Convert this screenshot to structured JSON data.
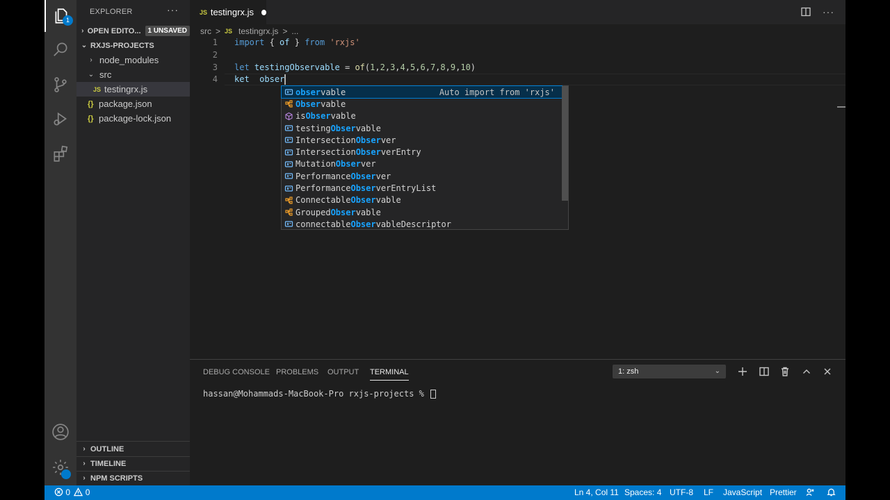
{
  "activity": {
    "explorer_badge": "1"
  },
  "sidebar": {
    "title": "EXPLORER",
    "more": "···",
    "open_editors": {
      "label": "OPEN EDITO...",
      "badge": "1 UNSAVED"
    },
    "project": "RXJS-PROJECTS",
    "tree": [
      {
        "label": "node_modules",
        "type": "folder"
      },
      {
        "label": "src",
        "type": "folder-open"
      },
      {
        "label": "testingrx.js",
        "type": "js",
        "icon": "JS"
      },
      {
        "label": "package.json",
        "type": "json",
        "icon": "{}"
      },
      {
        "label": "package-lock.json",
        "type": "json",
        "icon": "{}"
      }
    ],
    "sections": [
      "OUTLINE",
      "TIMELINE",
      "NPM SCRIPTS"
    ]
  },
  "tab": {
    "icon": "JS",
    "label": "testingrx.js"
  },
  "tab_actions": {
    "more": "···"
  },
  "breadcrumb": {
    "folder": "src",
    "sep": ">",
    "icon": "JS",
    "file": "testingrx.js",
    "more": "..."
  },
  "code": {
    "lines": [
      {
        "n": "1",
        "tokens": [
          [
            "kw",
            "import"
          ],
          [
            "pl",
            " { "
          ],
          [
            "var",
            "of"
          ],
          [
            "pl",
            " } "
          ],
          [
            "kw",
            "from"
          ],
          [
            "pl",
            " "
          ],
          [
            "str",
            "'rxjs'"
          ]
        ]
      },
      {
        "n": "2",
        "tokens": []
      },
      {
        "n": "3",
        "tokens": [
          [
            "kw",
            "let"
          ],
          [
            "pl",
            " "
          ],
          [
            "var",
            "testingObservable"
          ],
          [
            "pl",
            " = "
          ],
          [
            "fn",
            "of"
          ],
          [
            "pl",
            "("
          ],
          [
            "num",
            "1"
          ],
          [
            "pl",
            ","
          ],
          [
            "num",
            "2"
          ],
          [
            "pl",
            ","
          ],
          [
            "num",
            "3"
          ],
          [
            "pl",
            ","
          ],
          [
            "num",
            "4"
          ],
          [
            "pl",
            ","
          ],
          [
            "num",
            "5"
          ],
          [
            "pl",
            ","
          ],
          [
            "num",
            "6"
          ],
          [
            "pl",
            ","
          ],
          [
            "num",
            "7"
          ],
          [
            "pl",
            ","
          ],
          [
            "num",
            "8"
          ],
          [
            "pl",
            ","
          ],
          [
            "num",
            "9"
          ],
          [
            "pl",
            ","
          ],
          [
            "num",
            "10"
          ],
          [
            "pl",
            ")"
          ]
        ]
      },
      {
        "n": "4",
        "tokens": [
          [
            "var",
            "ket"
          ],
          [
            "pl",
            "  "
          ],
          [
            "var",
            "obser"
          ]
        ]
      }
    ]
  },
  "suggest": {
    "items": [
      {
        "icon": "variable",
        "pre": "",
        "match": "obser",
        "post": "vable",
        "detail": "Auto import from 'rxjs'"
      },
      {
        "icon": "class",
        "pre": "",
        "match": "Obser",
        "post": "vable",
        "detail": ""
      },
      {
        "icon": "module",
        "pre": "is",
        "match": "Obser",
        "post": "vable",
        "detail": ""
      },
      {
        "icon": "variable",
        "pre": "testing",
        "match": "Obser",
        "post": "vable",
        "detail": ""
      },
      {
        "icon": "variable",
        "pre": "Intersection",
        "match": "Obser",
        "post": "ver",
        "detail": ""
      },
      {
        "icon": "variable",
        "pre": "Intersection",
        "match": "Obser",
        "post": "verEntry",
        "detail": ""
      },
      {
        "icon": "variable",
        "pre": "Mutation",
        "match": "Obser",
        "post": "ver",
        "detail": ""
      },
      {
        "icon": "variable",
        "pre": "Performance",
        "match": "Obser",
        "post": "ver",
        "detail": ""
      },
      {
        "icon": "variable",
        "pre": "Performance",
        "match": "Obser",
        "post": "verEntryList",
        "detail": ""
      },
      {
        "icon": "class",
        "pre": "Connectable",
        "match": "Obser",
        "post": "vable",
        "detail": ""
      },
      {
        "icon": "class",
        "pre": "Grouped",
        "match": "Obser",
        "post": "vable",
        "detail": ""
      },
      {
        "icon": "variable",
        "pre": "connectable",
        "match": "Obser",
        "post": "vableDescriptor",
        "detail": ""
      }
    ]
  },
  "panel": {
    "tabs": [
      "DEBUG CONSOLE",
      "PROBLEMS",
      "OUTPUT",
      "TERMINAL"
    ],
    "active_tab": "TERMINAL",
    "terminal_select": "1: zsh",
    "prompt": "hassan@Mohammads-MacBook-Pro rxjs-projects % "
  },
  "status": {
    "errors": "0",
    "warnings": "0",
    "position": "Ln 4, Col 11",
    "spaces": "Spaces: 4",
    "encoding": "UTF-8",
    "eol": "LF",
    "language": "JavaScript",
    "formatter": "Prettier"
  },
  "colors": {
    "accent": "#007acc",
    "match": "#18a3ff",
    "keyword": "#569cd6",
    "string": "#ce9178"
  }
}
